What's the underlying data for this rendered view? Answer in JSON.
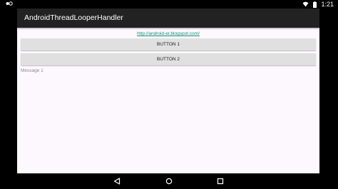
{
  "status_bar": {
    "left_icon": "notification-icon",
    "wifi_icon": "wifi-icon",
    "battery_icon": "battery-icon",
    "time": "1:21"
  },
  "app": {
    "title": "AndroidThreadLooperHandler",
    "link_text": "http://android-er.blogspot.com/",
    "buttons": [
      {
        "label": "BUTTON 1"
      },
      {
        "label": "BUTTON 2"
      }
    ],
    "message": "Message 1"
  },
  "nav_bar": {
    "back_icon": "back-triangle-icon",
    "home_icon": "home-circle-icon",
    "recent_icon": "recent-apps-square-icon"
  }
}
